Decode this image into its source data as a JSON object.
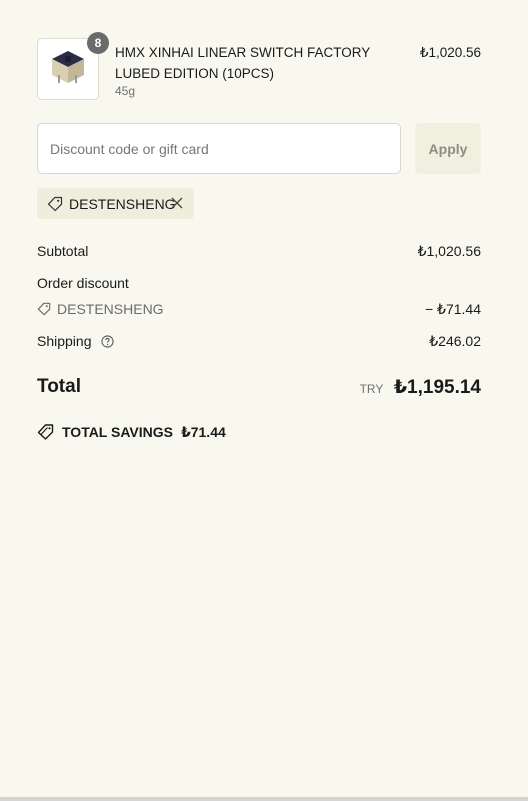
{
  "product": {
    "quantity": "8",
    "title": "HMX XINHAI LINEAR SWITCH FACTORY LUBED EDITION (10PCS)",
    "weight": "45g",
    "price": "₺1,020.56"
  },
  "discount": {
    "placeholder": "Discount code or gift card",
    "apply_label": "Apply",
    "applied_code": "DESTENSHENG"
  },
  "summary": {
    "subtotal_label": "Subtotal",
    "subtotal_value": "₺1,020.56",
    "order_discount_label": "Order discount",
    "discount_code": "DESTENSHENG",
    "discount_value": "− ₺71.44",
    "shipping_label": "Shipping",
    "shipping_value": "₺246.02"
  },
  "total": {
    "label": "Total",
    "currency": "TRY",
    "amount": "₺1,195.14"
  },
  "savings": {
    "label": "TOTAL SAVINGS",
    "amount": "₺71.44"
  },
  "colors": {
    "background": "#f9f8ef",
    "tag_background": "#efeedd",
    "badge": "#6b6b6b"
  },
  "icons": [
    "tag-icon",
    "close-icon",
    "help-circle-icon",
    "product-image"
  ]
}
